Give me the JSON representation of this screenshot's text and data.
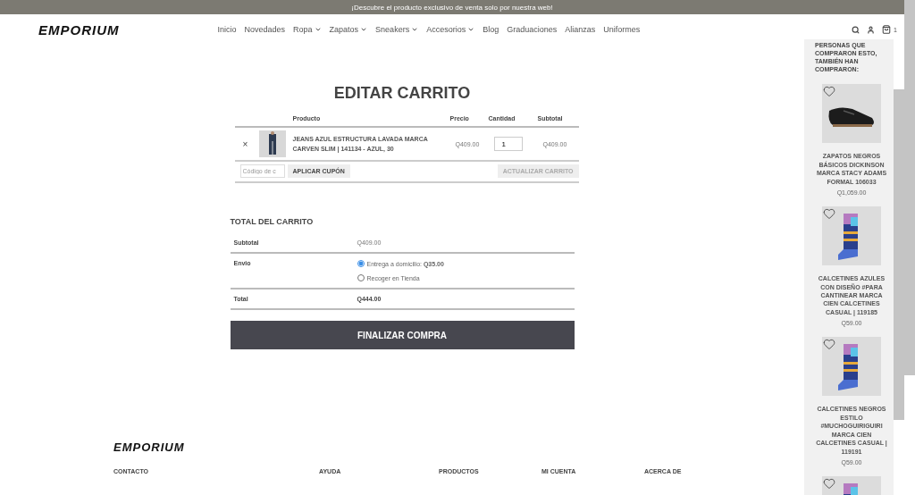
{
  "banner": {
    "text": "¡Descubre el producto exclusivo de venta solo por nuestra web!"
  },
  "header": {
    "logo": "EMPORIUM",
    "nav": [
      {
        "label": "Inicio",
        "dropdown": false
      },
      {
        "label": "Novedades",
        "dropdown": false
      },
      {
        "label": "Ropa",
        "dropdown": true
      },
      {
        "label": "Zapatos",
        "dropdown": true
      },
      {
        "label": "Sneakers",
        "dropdown": true
      },
      {
        "label": "Accesorios",
        "dropdown": true
      },
      {
        "label": "Blog",
        "dropdown": false
      },
      {
        "label": "Graduaciones",
        "dropdown": false
      },
      {
        "label": "Alianzas",
        "dropdown": false
      },
      {
        "label": "Uniformes",
        "dropdown": false
      }
    ],
    "cart_count": "1"
  },
  "page_title": "EDITAR CARRITO",
  "cart": {
    "columns": [
      "Producto",
      "Precio",
      "Cantidad",
      "Subtotal"
    ],
    "rows": [
      {
        "remove": "×",
        "name": "JEANS AZUL ESTRUCTURA LAVADA MARCA CARVEN SLIM | 141134 - AZUL, 30",
        "price": "Q409.00",
        "quantity": "1",
        "subtotal": "Q409.00"
      }
    ],
    "coupon_placeholder": "Código de c",
    "apply_button": "APLICAR CUPÓN",
    "update_button": {
      "label": "ACTUALIZAR CARRITO",
      "disabled": true
    }
  },
  "totals": {
    "title": "TOTAL DEL CARRITO",
    "subtotal_label": "Subtotal",
    "subtotal": "Q409.00",
    "shipping_label": "Envio",
    "shipping_options": [
      {
        "label": "Entrega a domicilio: **Q35.00**",
        "selected": true
      },
      {
        "label": "Recoger en Tienda",
        "selected": false
      }
    ],
    "total_label": "Total",
    "total": "Q444.00",
    "checkout_button": "FINALIZAR COMPRA"
  },
  "sidebar": {
    "title": "PERSONAS QUE COMPRARON ESTO, TAMBIÉN HAN COMPRARON:",
    "products": [
      {
        "kind": "shoe",
        "name": "ZAPATOS NEGROS BÁSICOS DICKINSON MARCA STACY ADAMS FORMAL 106033",
        "price": "Q1,059.00"
      },
      {
        "kind": "sock",
        "name": "CALCETINES AZULES CON DISEÑO #PARA CANTINEAR MARCA CIEN CALCETINES CASUAL | 119185",
        "price": "Q59.00"
      },
      {
        "kind": "sock",
        "name": "CALCETINES NEGROS ESTILO #MUCHOGUIRIGUIRI MARCA CIEN CALCETINES CASUAL | 119191",
        "price": "Q59.00"
      },
      {
        "kind": "sock"
      }
    ]
  },
  "footer": {
    "logo": "EMPORIUM",
    "columns": [
      "CONTACTO",
      "AYUDA",
      "PRODUCTOS",
      "MI CUENTA",
      "ACERCA DE"
    ]
  }
}
